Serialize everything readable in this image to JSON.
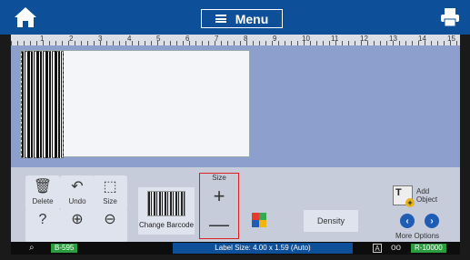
{
  "header": {
    "menu_label": "Menu",
    "home_icon": "home-icon",
    "print_icon": "printer-icon",
    "background": "#0e4f9a"
  },
  "ruler": {
    "numbers": [
      "1",
      "2",
      "3",
      "4",
      "5",
      "6",
      "7",
      "8",
      "9",
      "10",
      "11",
      "12",
      "13",
      "14",
      "15"
    ]
  },
  "toolbar": {
    "delete_label": "Delete",
    "undo_label": "Undo",
    "size_label": "Size",
    "help_icon": "question-icon",
    "zoom_in_icon": "zoom-in-icon",
    "zoom_out_icon": "zoom-out-icon",
    "change_barcode_label": "Change Barcode",
    "size_group_label": "Size",
    "density_label": "Density",
    "add_object_label_1": "Add",
    "add_object_label_2": "Object",
    "more_options_label": "More Options"
  },
  "status": {
    "left_tag": "B-595",
    "label_size": "Label Size: 4.00 x 1.59 (Auto)",
    "a_indicator": "A",
    "ribbon_tag": "R-10000"
  },
  "colors": {
    "canvas_bg": "#8d9fcc",
    "highlight_box": "#e02020",
    "status_green": "#2b9d3e"
  }
}
